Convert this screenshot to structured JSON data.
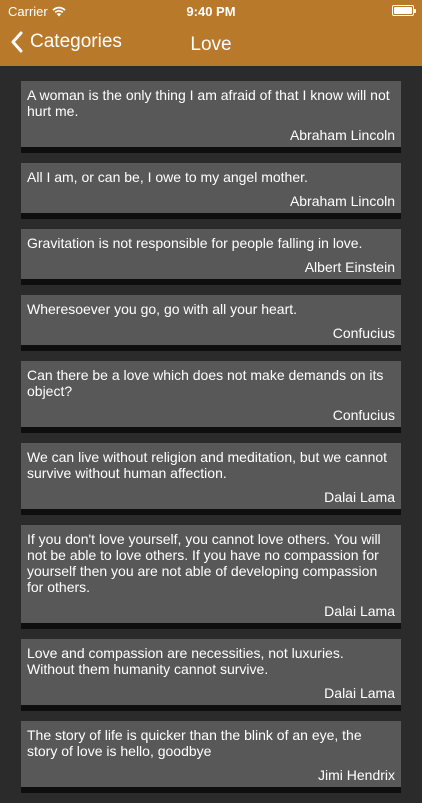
{
  "status": {
    "carrier": "Carrier",
    "time": "9:40 PM"
  },
  "nav": {
    "back_label": "Categories",
    "title": "Love"
  },
  "quotes": [
    {
      "text": "A woman is the only thing I am afraid of that I know will not hurt me.",
      "author": "Abraham Lincoln"
    },
    {
      "text": "All I am, or can be, I owe to my angel mother.",
      "author": "Abraham Lincoln"
    },
    {
      "text": "Gravitation is not responsible for people falling in love.",
      "author": "Albert Einstein"
    },
    {
      "text": "Wheresoever you go, go with all your heart.",
      "author": "Confucius"
    },
    {
      "text": "Can there be a love which does not make demands on its object?",
      "author": "Confucius"
    },
    {
      "text": "We can live without religion and meditation, but we cannot survive without human affection.",
      "author": "Dalai Lama"
    },
    {
      "text": "If you don't love yourself, you cannot love others. You will not be able to love others. If you have no compassion for yourself then you are not able of developing compassion for others.",
      "author": "Dalai Lama"
    },
    {
      "text": "Love and compassion are necessities, not luxuries. Without them humanity cannot survive.",
      "author": "Dalai Lama"
    },
    {
      "text": "The story of life is quicker than the blink of an eye, the story of love is hello, goodbye",
      "author": "Jimi Hendrix"
    }
  ]
}
